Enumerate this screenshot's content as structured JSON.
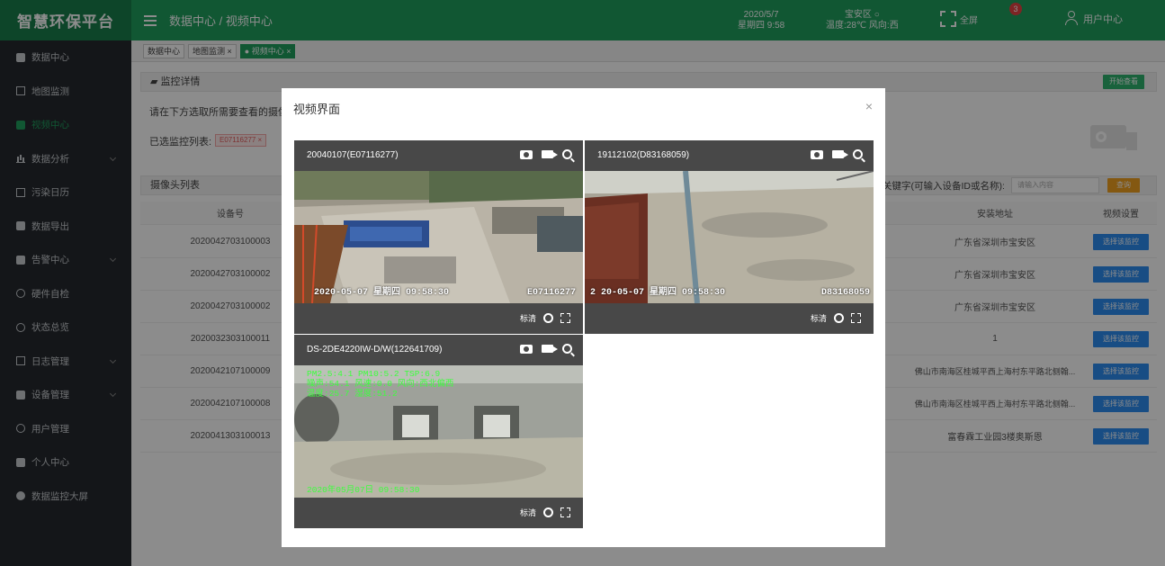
{
  "app": {
    "title": "智慧环保平台"
  },
  "header": {
    "breadcrumb": "数据中心 / 视频中心",
    "date": "2020/5/7",
    "weekday_time": "星期四 9:58",
    "district": "宝安区",
    "weather": "温度:28℃ 风向:西",
    "fullscreen_label": "全屏",
    "badge_count": "3",
    "user_label": "用户中心"
  },
  "sidebar": {
    "items": [
      {
        "label": "数据中心",
        "icon": "home-icon"
      },
      {
        "label": "地图监测",
        "icon": "map-icon"
      },
      {
        "label": "视频中心",
        "icon": "camera-icon"
      },
      {
        "label": "数据分析",
        "icon": "chart-icon"
      },
      {
        "label": "污染日历",
        "icon": "calendar-icon"
      },
      {
        "label": "数据导出",
        "icon": "cloud-icon"
      },
      {
        "label": "告警中心",
        "icon": "bell-icon"
      },
      {
        "label": "硬件自检",
        "icon": "gear-icon"
      },
      {
        "label": "状态总览",
        "icon": "status-icon"
      },
      {
        "label": "日志管理",
        "icon": "log-icon"
      },
      {
        "label": "设备管理",
        "icon": "device-icon"
      },
      {
        "label": "用户管理",
        "icon": "users-icon"
      },
      {
        "label": "个人中心",
        "icon": "person-icon"
      },
      {
        "label": "数据监控大屏",
        "icon": "screen-icon"
      }
    ]
  },
  "tabs": [
    {
      "label": "数据中心"
    },
    {
      "label": "地图监测 ×"
    },
    {
      "label": "● 视频中心 ×"
    }
  ],
  "monitor": {
    "heading": "监控详情",
    "start_button": "开始查看",
    "instruction": "请在下方选取所需要查看的摄像",
    "selected_label": "已选监控列表:",
    "selected_tag": "E07116277 ×"
  },
  "camera_list": {
    "heading": "摄像头列表",
    "search_label": "关键字(可输入设备ID或名称):",
    "search_placeholder": "请输入内容",
    "search_button": "查询",
    "columns": [
      "设备号",
      "安装地址",
      "视频设置"
    ],
    "rows": [
      {
        "device": "2020042703100003",
        "address": "广东省深圳市宝安区",
        "action": "选择该监控"
      },
      {
        "device": "2020042703100002",
        "address": "广东省深圳市宝安区",
        "action": "选择该监控"
      },
      {
        "device": "2020042703100002",
        "address": "广东省深圳市宝安区",
        "action": "选择该监控"
      },
      {
        "device": "2020032303100011",
        "address": "1",
        "action": "选择该监控"
      },
      {
        "device": "2020042107100009",
        "address": "佛山市南海区桂城平西上海村东平路北侧翰...",
        "action": "选择该监控"
      },
      {
        "device": "2020042107100008",
        "address": "佛山市南海区桂城平西上海村东平路北侧翰...",
        "action": "选择该监控"
      },
      {
        "device": "2020041303100013",
        "address": "富春霖工业园3楼奥斯恩",
        "action": "选择该监控"
      }
    ]
  },
  "modal": {
    "title": "视频界面",
    "close": "×",
    "videos": [
      {
        "title": "20040107(E07116277)",
        "osd": "2020-05-07 星期四 09:58:30",
        "osd_id": "E07116277",
        "quality": "标清"
      },
      {
        "title": "19112102(D83168059)",
        "osd": "2 20-05-07 星期四 09:58:30",
        "osd_id": "D83168059",
        "quality": "标清"
      },
      {
        "title": "DS-2DE4220IW-D/W(122641709)",
        "osd_line1": "PM2.5:4.1  PM10:5.2  TSP:6.9",
        "osd_line2": "噪声:54.1  风速:0.0  风向:西北偏西",
        "osd_line3": "温度:25.7  湿度:51.2",
        "osd_date": "2020年05月07日 09:58:30",
        "quality": "标清"
      }
    ]
  },
  "colors": {
    "brand": "#1f9e5e",
    "sidebar_bg": "#25292e",
    "button_blue": "#2d8cf0",
    "button_orange": "#f0a020",
    "tag_red": "#e35d5d"
  }
}
